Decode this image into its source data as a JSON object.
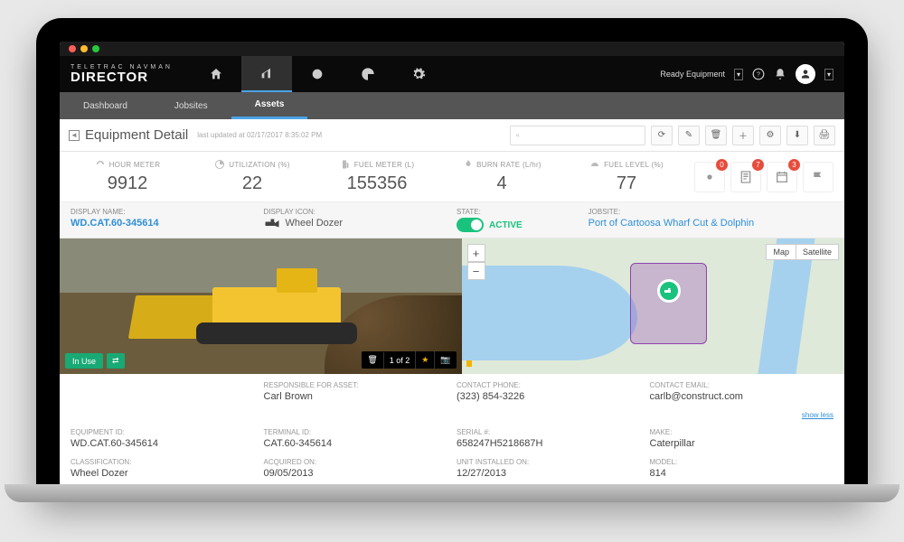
{
  "brand": {
    "top": "TELETRAC NAVMAN",
    "bottom": "DIRECTOR"
  },
  "topnav": {
    "company": "Ready Equipment"
  },
  "subnav": {
    "tabs": [
      "Dashboard",
      "Jobsites",
      "Assets"
    ],
    "active": 2
  },
  "page": {
    "title": "Equipment Detail",
    "last_updated": "last updated at 02/17/2017 8:35:02 PM"
  },
  "search": {
    "placeholder": ""
  },
  "kpis": {
    "hour_meter": {
      "label": "HOUR METER",
      "value": "9912"
    },
    "utilization": {
      "label": "UTILIZATION (%)",
      "value": "22"
    },
    "fuel_meter": {
      "label": "FUEL METER (L)",
      "value": "155356"
    },
    "burn_rate": {
      "label": "BURN RATE (L/hr)",
      "value": "4"
    },
    "fuel_level": {
      "label": "FUEL LEVEL (%)",
      "value": "77"
    }
  },
  "alerts": {
    "settings": "0",
    "checklist": "7",
    "schedule": "3"
  },
  "info": {
    "display_name_label": "DISPLAY NAME:",
    "display_name": "WD.CAT.60-345614",
    "display_icon_label": "DISPLAY ICON:",
    "display_icon": "Wheel Dozer",
    "state_label": "STATE:",
    "state": "ACTIVE",
    "jobsite_label": "JOBSITE:",
    "jobsite": "Port of Cartoosa Wharf Cut & Dolphin"
  },
  "photo": {
    "in_use": "In Use",
    "counter": "1 of 2"
  },
  "map": {
    "type_map": "Map",
    "type_sat": "Satellite",
    "zoom_in": "+",
    "zoom_out": "−"
  },
  "contact": {
    "responsible_label": "RESPONSIBLE FOR ASSET:",
    "responsible": "Carl Brown",
    "phone_label": "CONTACT PHONE:",
    "phone": "(323) 854-3226",
    "email_label": "CONTACT EMAIL:",
    "email": "carlb@construct.com",
    "show_less": "show less"
  },
  "details": {
    "equipment_id_label": "EQUIPMENT ID:",
    "equipment_id": "WD.CAT.60-345614",
    "terminal_id_label": "TERMINAL ID:",
    "terminal_id": "CAT.60-345614",
    "serial_label": "SERIAL #:",
    "serial": "658247H5218687H",
    "make_label": "MAKE:",
    "make": "Caterpillar",
    "classification_label": "CLASSIFICATION:",
    "classification": "Wheel Dozer",
    "acquired_label": "ACQUIRED ON:",
    "acquired": "09/05/2013",
    "installed_label": "UNIT INSTALLED ON:",
    "installed": "12/27/2013",
    "model_label": "MODEL:",
    "model": "814"
  }
}
